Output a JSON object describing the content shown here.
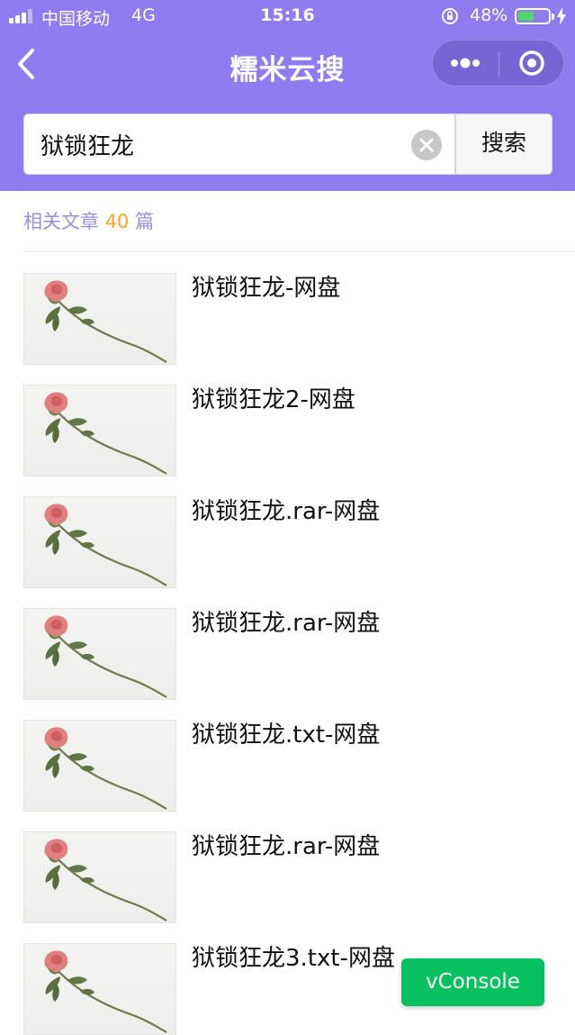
{
  "status_bar": {
    "carrier": "中国移动",
    "network": "4G",
    "time": "15:16",
    "battery_percent": "48%",
    "battery_level": 0.48
  },
  "nav": {
    "title": "糯米云搜",
    "back_icon": "chevron-left-icon",
    "more_icon": "more-dots-icon",
    "close_icon": "target-circle-icon"
  },
  "search": {
    "value": "狱锁狂龙",
    "placeholder": "",
    "button_label": "搜索"
  },
  "results": {
    "label_prefix": "相关文章",
    "count": "40",
    "label_suffix": "篇",
    "items": [
      {
        "title": "狱锁狂龙-网盘"
      },
      {
        "title": "狱锁狂龙2-网盘"
      },
      {
        "title": "狱锁狂龙.rar-网盘"
      },
      {
        "title": "狱锁狂龙.rar-网盘"
      },
      {
        "title": "狱锁狂龙.txt-网盘"
      },
      {
        "title": "狱锁狂龙.rar-网盘"
      },
      {
        "title": "狱锁狂龙3.txt-网盘"
      }
    ]
  },
  "vconsole": {
    "label": "vConsole"
  },
  "colors": {
    "header": "#8f7cf0",
    "accent_count": "#f5a623",
    "summary_text": "#9a8fd6",
    "vconsole": "#07c160"
  }
}
